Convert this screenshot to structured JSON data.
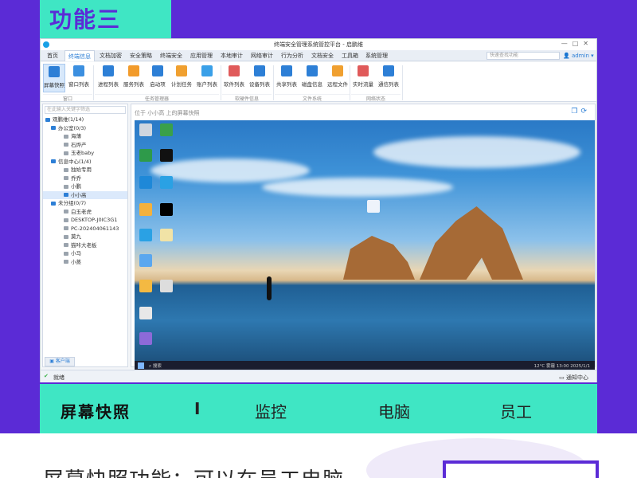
{
  "banner": {
    "title": "功能三"
  },
  "window": {
    "title": "终端安全管理系统管控平台 - 启鹏维",
    "menu": [
      "首页",
      "终端信息",
      "文档加密",
      "安全策略",
      "终端安全",
      "应用管理",
      "本地审计",
      "网络审计",
      "行为分析",
      "文档安全",
      "工具箱",
      "系统管理"
    ],
    "active_menu_index": 1,
    "search_placeholder": "快速查找功能",
    "user": "admin",
    "ribbon_buttons": [
      "屏幕快照",
      "窗口列表",
      "进程列表",
      "服务列表",
      "启动项",
      "计划任务",
      "账户列表",
      "软件列表",
      "设备列表",
      "共享列表",
      "磁盘信息",
      "远程文件",
      "实时流量",
      "通信列表"
    ],
    "ribbon_groups": [
      "窗口",
      "任务管理器",
      "软硬件信息",
      "文件系统",
      "网络状态"
    ],
    "sidebar_filter_placeholder": "在此输入关键字筛选",
    "tree": [
      {
        "label": "观鹏维(1/14)",
        "level": 0,
        "type": "root"
      },
      {
        "label": "办公室(0/3)",
        "level": 1,
        "type": "group"
      },
      {
        "label": "海薄",
        "level": 2,
        "type": "pc"
      },
      {
        "label": "石烨产",
        "level": 2,
        "type": "pc"
      },
      {
        "label": "玉老baby",
        "level": 2,
        "type": "pc"
      },
      {
        "label": "信息中心(1/4)",
        "level": 1,
        "type": "group"
      },
      {
        "label": "独始专用",
        "level": 2,
        "type": "pc"
      },
      {
        "label": "乔乔",
        "level": 2,
        "type": "pc"
      },
      {
        "label": "小鹏",
        "level": 2,
        "type": "pc"
      },
      {
        "label": "小小高",
        "level": 2,
        "type": "pc",
        "selected": true
      },
      {
        "label": "未分组(0/7)",
        "level": 1,
        "type": "group"
      },
      {
        "label": "白玉老虎",
        "level": 2,
        "type": "pc"
      },
      {
        "label": "DESKTOP-J0IC3G1",
        "level": 2,
        "type": "pc"
      },
      {
        "label": "PC-202404061143",
        "level": 2,
        "type": "pc"
      },
      {
        "label": "莫九",
        "level": 2,
        "type": "pc"
      },
      {
        "label": "猫咔大老板",
        "level": 2,
        "type": "pc"
      },
      {
        "label": "小马",
        "level": 2,
        "type": "pc"
      },
      {
        "label": "小蒸",
        "level": 2,
        "type": "pc"
      }
    ],
    "sidebar_tab": "客户端",
    "panel_title": "位于 小小高 上的屏幕快照",
    "panel_icons": [
      "copy-icon",
      "refresh-icon"
    ],
    "desktop": {
      "taskbar_search": "搜索",
      "tray_text": "12°C 雾霾  13:00",
      "date": "2025/1/1"
    },
    "status": {
      "ready": "就绪",
      "notify": "通知中心"
    }
  },
  "features": {
    "main": "屏幕快照",
    "separator": "I",
    "items": [
      "监控",
      "电脑",
      "员工"
    ]
  },
  "caption": "屏幕快照功能：可以在员工电脑",
  "colors": {
    "purple": "#5b2bd6",
    "teal": "#3fe6c4",
    "accent": "#2d7fd6"
  }
}
